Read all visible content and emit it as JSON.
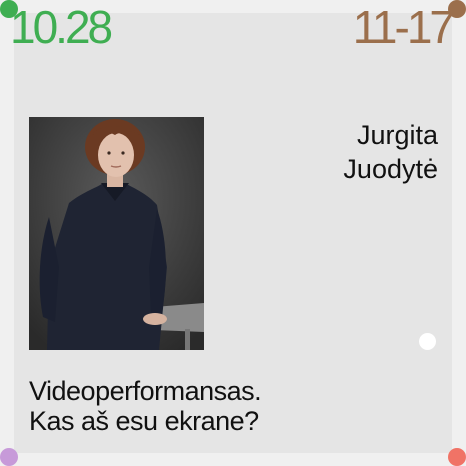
{
  "dates": {
    "start": "10.28",
    "end": "11-17"
  },
  "speaker": {
    "first_name": "Jurgita",
    "last_name": "Juodytė"
  },
  "title": {
    "line1": "Videoperformansas.",
    "line2": "Kas aš esu ekrane?"
  },
  "colors": {
    "start_date": "#3fae52",
    "end_date": "#9b6f4c",
    "dot_top_left": "#3fae52",
    "dot_top_right": "#9b6f4c",
    "dot_bottom_left": "#c79ad9",
    "dot_bottom_right": "#f07366",
    "accent_dot": "#ffffff"
  }
}
